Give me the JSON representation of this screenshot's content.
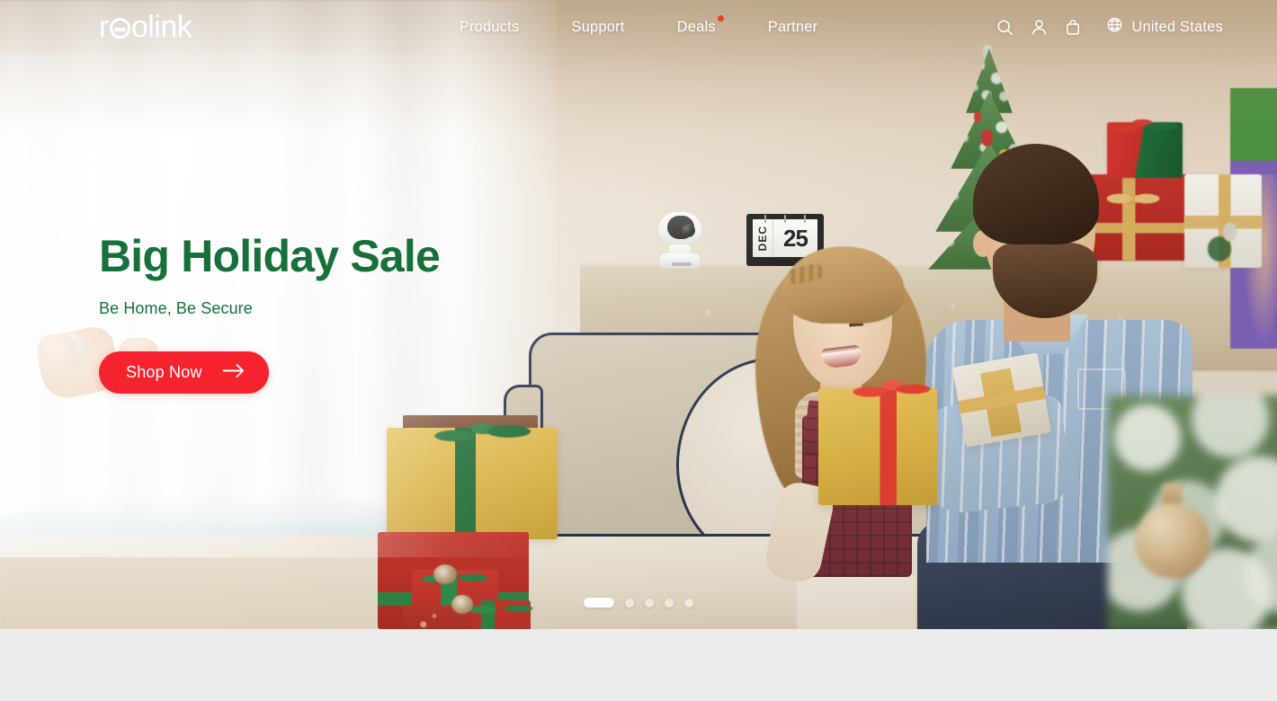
{
  "brand": {
    "name": "reolink",
    "logo_part_1": "r",
    "logo_part_2": "olink"
  },
  "header": {
    "nav": [
      {
        "label": "Products",
        "badge": false
      },
      {
        "label": "Support",
        "badge": false
      },
      {
        "label": "Deals",
        "badge": true
      },
      {
        "label": "Partner",
        "badge": false
      }
    ],
    "icons": [
      {
        "name": "search-icon",
        "label": "Search"
      },
      {
        "name": "account-icon",
        "label": "Account"
      },
      {
        "name": "cart-icon",
        "label": "Cart"
      }
    ],
    "region": {
      "icon": "globe-icon",
      "label": "United States"
    },
    "badge_color": "#e8401f",
    "text_color": "#ffffff"
  },
  "hero": {
    "title": "Big Holiday Sale",
    "subtitle": "Be Home, Be Secure",
    "title_color": "#16703a",
    "cta": {
      "label": "Shop Now",
      "icon": "arrow-right-icon",
      "background": "#F5232E",
      "text_color": "#ffffff"
    },
    "scene": {
      "calendar_month": "DEC",
      "calendar_day": "25"
    },
    "carousel": {
      "total_slides": 5,
      "active_index": 1,
      "slides": [
        {
          "active": true
        },
        {
          "active": false
        },
        {
          "active": false
        },
        {
          "active": false
        },
        {
          "active": false
        }
      ]
    }
  },
  "page": {
    "background_color": "#ececec"
  }
}
